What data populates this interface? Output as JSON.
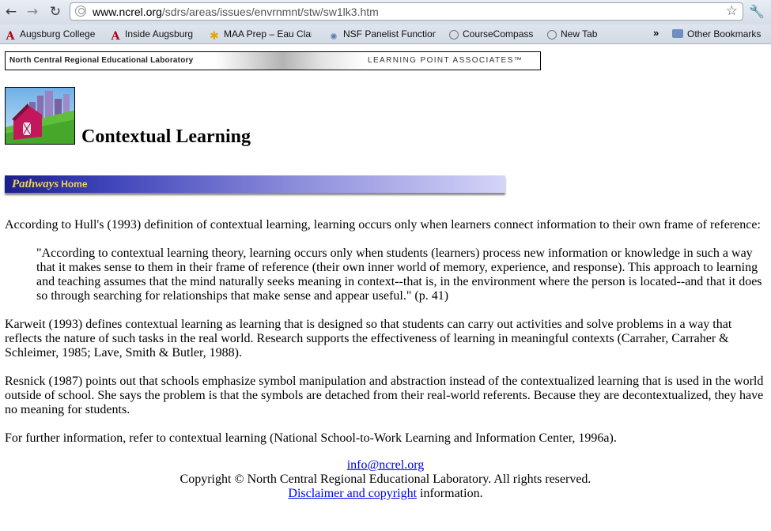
{
  "browser": {
    "url_host": "www.ncrel.org",
    "url_path": "/sdrs/areas/issues/envrnmnt/stw/sw1lk3.htm",
    "nav": {
      "back_icon": "back-arrow-icon",
      "forward_icon": "forward-arrow-icon",
      "reload_icon": "reload-icon"
    },
    "bookmarks": [
      {
        "label": "Augsburg College",
        "icon": "augsburg-icon"
      },
      {
        "label": "Inside Augsburg",
        "icon": "augsburg-icon"
      },
      {
        "label": "MAA Prep – Eau Clair",
        "icon": "maa-icon"
      },
      {
        "label": "NSF Panelist Function",
        "icon": "nsf-icon"
      },
      {
        "label": "CourseCompass",
        "icon": "globe-icon"
      },
      {
        "label": "New Tab",
        "icon": "globe-icon"
      }
    ],
    "overflow_label": "»",
    "other_bookmarks": "Other Bookmarks"
  },
  "banner": {
    "left_text": "North Central Regional Educational Laboratory",
    "right_text": "LEARNING POINT ASSOCIATES™"
  },
  "page": {
    "title": "Contextual Learning",
    "pathways_label": "Pathways",
    "home_label": "Home",
    "paragraphs": {
      "p1": "According to Hull's (1993) definition of contextual learning, learning occurs only when learners connect information to their own frame of reference:",
      "quote": "\"According to contextual learning theory, learning occurs only when students (learners) process new information or knowledge in such a way that it makes sense to them in their frame of reference (their own inner world of memory, experience, and response). This approach to learning and teaching assumes that the mind naturally seeks meaning in context--that is, in the environment where the person is located--and that it does so through searching for relationships that make sense and appear useful.\" (p. 41)",
      "p2": "Karweit (1993) defines contextual learning as learning that is designed so that students can carry out activities and solve problems in a way that reflects the nature of such tasks in the real world. Research supports the effectiveness of learning in meaningful contexts (Carraher, Carraher & Schleimer, 1985; Lave, Smith & Butler, 1988).",
      "p3": "Resnick (1987) points out that schools emphasize symbol manipulation and abstraction instead of the contextualized learning that is used in the world outside of school. She says the problem is that the symbols are detached from their real-world referents. Because they are decontextualized, they have no meaning for students.",
      "p4": "For further information, refer to contextual learning (National School-to-Work Learning and Information Center, 1996a)."
    }
  },
  "footer": {
    "email": "info@ncrel.org",
    "copyright": "Copyright © North Central Regional Educational Laboratory. All rights reserved.",
    "disclaimer_link": "Disclaimer and copyright",
    "disclaimer_suffix": " information."
  }
}
